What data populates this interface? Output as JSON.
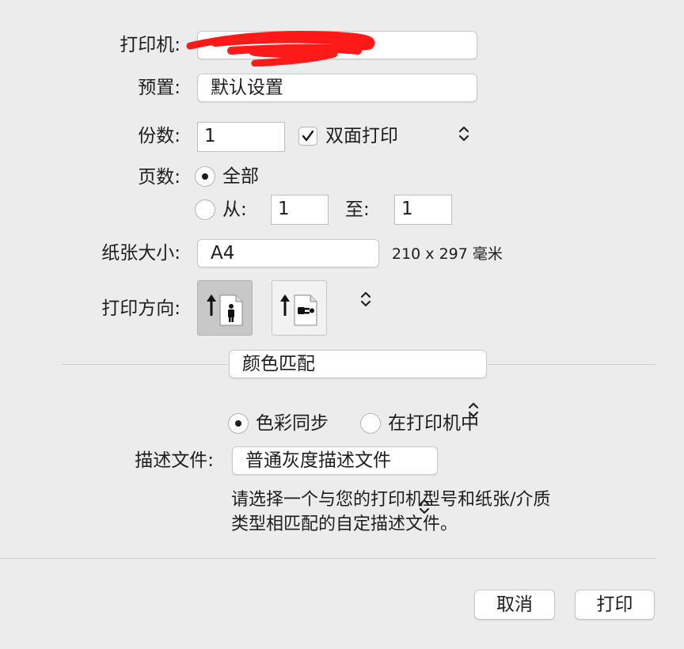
{
  "printer": {
    "label": "打印机:",
    "value": ""
  },
  "presets": {
    "label": "预置:",
    "value": "默认设置"
  },
  "copies": {
    "label": "份数:",
    "value": "1",
    "two_sided_label": "双面打印",
    "two_sided_checked": true
  },
  "pages": {
    "label": "页数:",
    "all_label": "全部",
    "from_label": "从:",
    "from_value": "1",
    "to_label": "至:",
    "to_value": "1",
    "selected": "all"
  },
  "paper_size": {
    "label": "纸张大小:",
    "value": "A4",
    "dimensions": "210 x 297 毫米"
  },
  "orientation": {
    "label": "打印方向:",
    "options": [
      "portrait-icon",
      "landscape-icon"
    ],
    "selected": "portrait"
  },
  "section": {
    "value": "颜色匹配"
  },
  "color": {
    "option_sync": "色彩同步",
    "option_printer": "在打印机中",
    "selected": "sync",
    "profile_label": "描述文件:",
    "profile_value": "普通灰度描述文件",
    "description_line1": "请选择一个与您的打印机型号和纸张/介质",
    "description_line2": "类型相匹配的自定描述文件。"
  },
  "buttons": {
    "cancel": "取消",
    "print": "打印"
  },
  "redaction_color": "#ff1a1a"
}
